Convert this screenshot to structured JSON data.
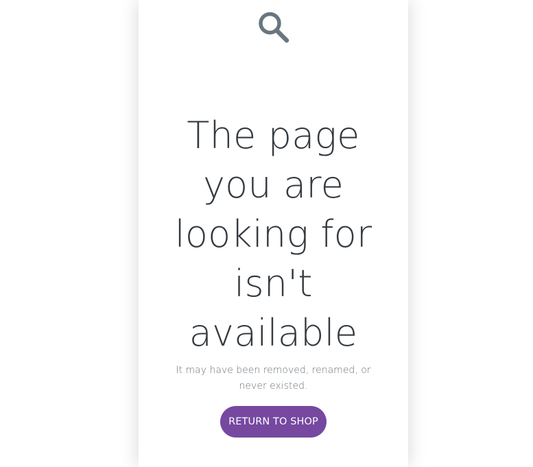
{
  "icon": {
    "name": "search-icon",
    "color": "#69767f"
  },
  "headline": {
    "lines": [
      "The page",
      "you are",
      "looking for",
      "isn't",
      "available"
    ]
  },
  "subtext": "It may have been removed, renamed, or never existed.",
  "button": {
    "label": "RETURN TO SHOP",
    "color": "#7648a0"
  }
}
